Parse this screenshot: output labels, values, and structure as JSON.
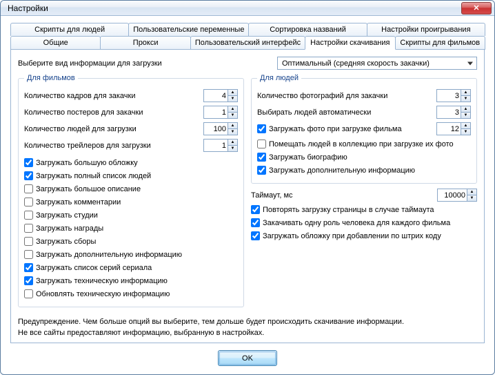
{
  "window": {
    "title": "Настройки"
  },
  "tabs_row1": [
    "Скрипты для людей",
    "Пользовательские переменные",
    "Сортировка названий",
    "Настройки проигрывания"
  ],
  "tabs_row2": [
    "Общие",
    "Прокси",
    "Пользовательский интерфейс",
    "Настройки скачивания",
    "Скрипты для фильмов"
  ],
  "active_tab_index_row2": 3,
  "info_type": {
    "label": "Выберите вид информации для загрузки",
    "selected": "Оптимальный (средняя скорость закачки)"
  },
  "movies": {
    "legend": "Для фильмов",
    "frames": {
      "label": "Количество кадров для закачки",
      "value": 4
    },
    "posters": {
      "label": "Количество постеров для закачки",
      "value": 1
    },
    "people": {
      "label": "Количество людей для загрузки",
      "value": 100
    },
    "trailers": {
      "label": "Количество трейлеров для загрузки",
      "value": 1
    },
    "opts": [
      {
        "label": "Загружать большую обложку",
        "checked": true
      },
      {
        "label": "Загружать полный список людей",
        "checked": true
      },
      {
        "label": "Загружать большое описание",
        "checked": false
      },
      {
        "label": "Загружать комментарии",
        "checked": false
      },
      {
        "label": "Загружать студии",
        "checked": false
      },
      {
        "label": "Загружать награды",
        "checked": false
      },
      {
        "label": "Загружать сборы",
        "checked": false
      },
      {
        "label": "Загружать дополнительную информацию",
        "checked": false
      },
      {
        "label": "Загружать список серий сериала",
        "checked": true
      },
      {
        "label": "Загружать техническую информацию",
        "checked": true
      },
      {
        "label": "Обновлять техническую информацию",
        "checked": false
      }
    ]
  },
  "people_fs": {
    "legend": "Для людей",
    "photos": {
      "label": "Количество фотографий для закачки",
      "value": 3
    },
    "auto": {
      "label": "Выбирать людей автоматически",
      "value": 3
    },
    "photo_on_movie": {
      "label": "Загружать фото при загрузке фильма",
      "checked": true,
      "value": 12
    },
    "put_collection": {
      "label": "Помещать людей в коллекцию при загрузке их фото",
      "checked": false
    },
    "bio": {
      "label": "Загружать биографию",
      "checked": true
    },
    "extra": {
      "label": "Загружать дополнительную информацию",
      "checked": true
    }
  },
  "timeout": {
    "label": "Таймаут, мс",
    "value": 10000
  },
  "right_opts": [
    {
      "label": "Повторять загрузку страницы в случае таймаута",
      "checked": true
    },
    {
      "label": "Закачивать одну роль человека для каждого фильма",
      "checked": true
    },
    {
      "label": "Загружать обложку при добавлении по штрих коду",
      "checked": true
    }
  ],
  "warning": {
    "line1": "Предупреждение. Чем больше опций вы выберите, тем дольше будет происходить скачивание информации.",
    "line2": "Не все сайты предоставляют информацию, выбранную в настройках."
  },
  "buttons": {
    "ok": "OK"
  }
}
